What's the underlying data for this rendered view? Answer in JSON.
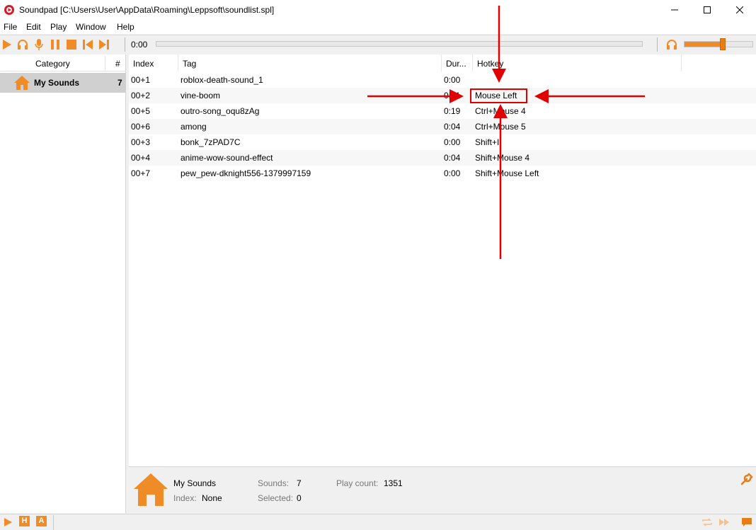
{
  "window": {
    "title": "Soundpad [C:\\Users\\User\\AppData\\Roaming\\Leppsoft\\soundlist.spl]",
    "controls": [
      "minimize",
      "maximize",
      "close"
    ]
  },
  "menu": [
    "File",
    "Edit",
    "Play",
    "Window",
    "Help"
  ],
  "toolbar": {
    "time": "0:00",
    "progress": 0,
    "volume_percent": 56,
    "accent_color": "#f08c28",
    "buttons": [
      "play-icon",
      "headphones-icon",
      "microphone-icon",
      "pause-icon",
      "stop-icon",
      "previous-icon",
      "next-icon"
    ]
  },
  "categories": {
    "header": {
      "category": "Category",
      "count": "#"
    },
    "items": [
      {
        "name": "My Sounds",
        "count": "7",
        "icon": "home-icon"
      }
    ]
  },
  "table": {
    "columns": [
      "Index",
      "Tag",
      "Dur...",
      "Hotkey"
    ],
    "rows": [
      {
        "index": "00+1",
        "tag": "roblox-death-sound_1",
        "duration": "0:00",
        "hotkey": ""
      },
      {
        "index": "00+2",
        "tag": "vine-boom",
        "duration": "0:01",
        "hotkey": "Mouse Left"
      },
      {
        "index": "00+5",
        "tag": "outro-song_oqu8zAg",
        "duration": "0:19",
        "hotkey": "Ctrl+Mouse 4"
      },
      {
        "index": "00+6",
        "tag": "among",
        "duration": "0:04",
        "hotkey": "Ctrl+Mouse 5"
      },
      {
        "index": "00+3",
        "tag": "bonk_7zPAD7C",
        "duration": "0:00",
        "hotkey": "Shift+I"
      },
      {
        "index": "00+4",
        "tag": "anime-wow-sound-effect",
        "duration": "0:04",
        "hotkey": "Shift+Mouse 4"
      },
      {
        "index": "00+7",
        "tag": "pew_pew-dknight556-1379997159",
        "duration": "0:00",
        "hotkey": "Shift+Mouse Left"
      }
    ]
  },
  "info": {
    "category_name": "My Sounds",
    "index_label": "Index:",
    "index_value": "None",
    "sounds_label": "Sounds:",
    "sounds_value": "7",
    "selected_label": "Selected:",
    "selected_value": "0",
    "playcount_label": "Play count:",
    "playcount_value": "1351"
  },
  "statusbar": {
    "h_label": "H",
    "a_label": "A"
  },
  "annotation_color": "#e00000"
}
